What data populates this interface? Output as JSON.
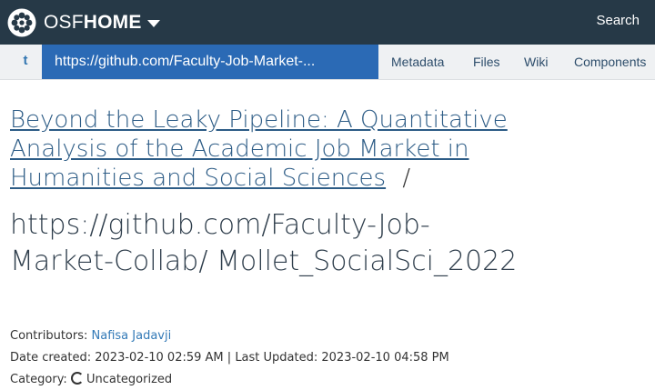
{
  "navbar": {
    "brand_light": "OSF",
    "brand_bold": "HOME",
    "logo_icon": "osf-flower-icon",
    "search_label": "Search",
    "background": "#263947"
  },
  "project_nav": {
    "toggle_label": "t",
    "active_label": "https://github.com/Faculty-Job-Market-...",
    "items": [
      "Metadata",
      "Files",
      "Wiki",
      "Components"
    ],
    "active_color": "#2b6ab5"
  },
  "content": {
    "parent_title": "Beyond the Leaky Pipeline: A Quantitative Analysis of the Academic Job Market in Humanities and Social Sciences",
    "separator": "/",
    "page_title": "https://github.com/Faculty-Job-Market-Collab/ Mollet_SocialSci_2022",
    "contributors_label": "Contributors:",
    "contributor_name": "Nafisa Jadavji",
    "date_created_label": "Date created:",
    "date_created": "2023-02-10 02:59 AM",
    "divider": "|",
    "last_updated_label": "Last Updated:",
    "last_updated": "2023-02-10 04:58 PM",
    "category_label": "Category:",
    "category_icon": "uncategorized-icon",
    "category_value": "Uncategorized"
  }
}
